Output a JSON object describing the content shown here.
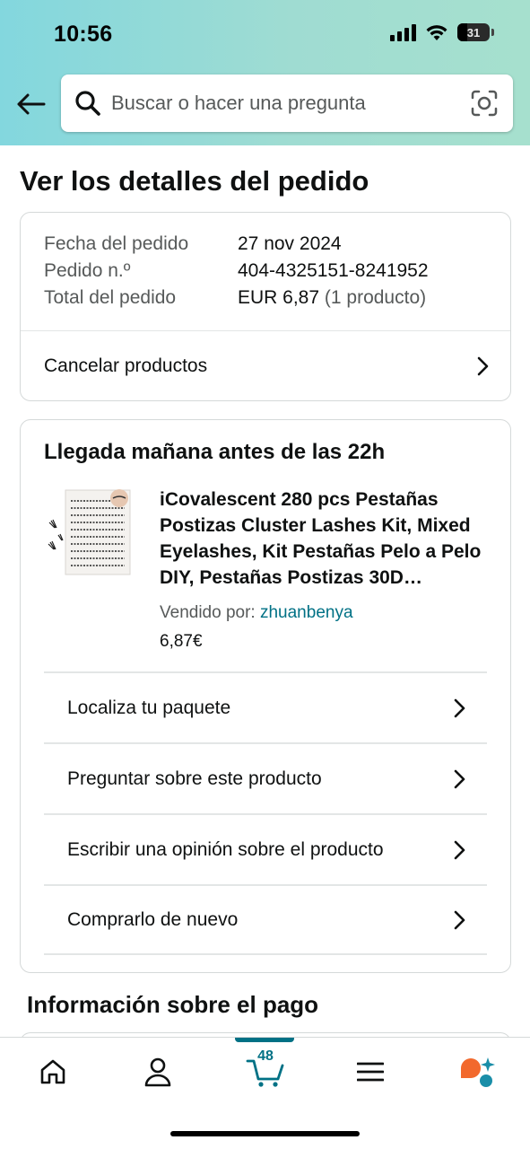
{
  "status": {
    "time": "10:56",
    "battery": "31"
  },
  "search": {
    "placeholder": "Buscar o hacer una pregunta"
  },
  "page": {
    "title": "Ver los detalles del pedido"
  },
  "order": {
    "date_label": "Fecha del pedido",
    "date": "27 nov 2024",
    "number_label": "Pedido n.º",
    "number": "404-4325151-8241952",
    "total_label": "Total del pedido",
    "total": "EUR 6,87",
    "total_count": "(1 producto)",
    "cancel_label": "Cancelar productos"
  },
  "shipment": {
    "arrival": "Llegada mañana antes de las 22h",
    "product_title": "iCovalescent 280 pcs Pestañas Postizas Cluster Lashes Kit, Mixed Eyelashes, Kit Pestañas Pelo a Pelo DIY, Pestañas Postizas 30D…",
    "seller_label": "Vendido por:",
    "seller": "zhuanbenya",
    "price": "6,87€",
    "actions": [
      {
        "label": "Localiza tu paquete"
      },
      {
        "label": "Preguntar sobre este producto"
      },
      {
        "label": "Escribir una opinión sobre el producto"
      },
      {
        "label": "Comprarlo de nuevo"
      }
    ]
  },
  "payment": {
    "title": "Información sobre el pago"
  },
  "tabbar": {
    "cart_count": "48",
    "accent": "#007185"
  },
  "icons": {
    "back": "arrow-left-icon",
    "search": "search-icon",
    "camera": "camera-scan-icon",
    "home": "home-icon",
    "account": "user-icon",
    "cart": "cart-icon",
    "menu": "menu-icon",
    "rufus": "rufus-icon"
  }
}
